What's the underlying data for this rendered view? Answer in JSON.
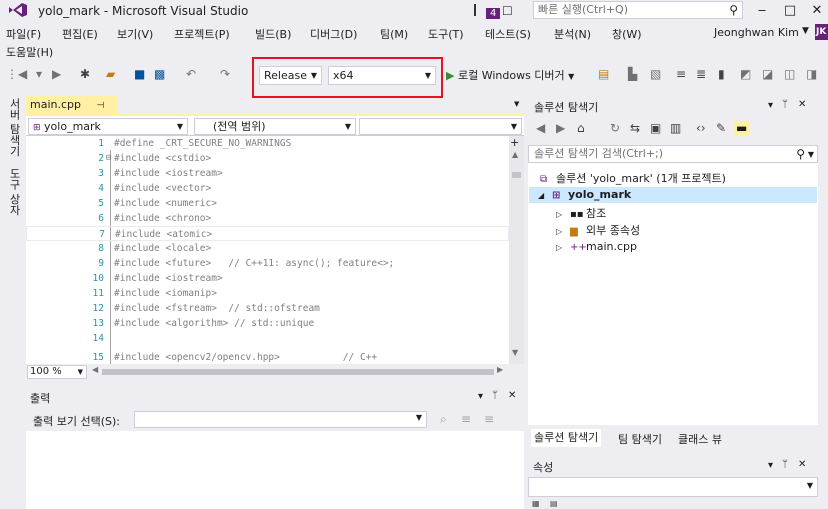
{
  "window": {
    "title": "yolo_mark - Microsoft Visual Studio",
    "notification_count": "4",
    "quick_launch_placeholder": "빠른 실행(Ctrl+Q)",
    "minimize": "‒",
    "maximize": "□",
    "close": "✕"
  },
  "menu": {
    "items": [
      "파일(F)",
      "편집(E)",
      "보기(V)",
      "프로젝트(P)",
      "빌드(B)",
      "디버그(D)",
      "팀(M)",
      "도구(T)",
      "테스트(S)",
      "분석(N)",
      "창(W)"
    ],
    "help": "도움말(H)",
    "user_name": "Jeonghwan Kim",
    "user_initials": "JK"
  },
  "toolbar": {
    "configuration": "Release",
    "platform": "x64",
    "run_label": "로컬 Windows 디버거"
  },
  "left_tabs": {
    "server_explorer": "서버 탐색기",
    "toolbox": "도구 상자"
  },
  "editor": {
    "file_tab": "main.cpp",
    "pin": "⊣",
    "close": "✕",
    "nav_project": "yolo_mark",
    "nav_scope": "(전역 범위)",
    "nav_member": "",
    "zoom": "100 %",
    "lines": [
      {
        "n": "1",
        "text": "#define _CRT_SECURE_NO_WARNINGS"
      },
      {
        "n": "2",
        "text": "#include <cstdio>"
      },
      {
        "n": "3",
        "text": "#include <iostream>"
      },
      {
        "n": "4",
        "text": "#include <vector>"
      },
      {
        "n": "5",
        "text": "#include <numeric>"
      },
      {
        "n": "6",
        "text": "#include <chrono>"
      },
      {
        "n": "7",
        "text": "#include <atomic>"
      },
      {
        "n": "8",
        "text": "#include <locale>"
      },
      {
        "n": "9",
        "text": "#include <future>   // C++11: async(); feature<>;"
      },
      {
        "n": "10",
        "text": "#include <iostream>"
      },
      {
        "n": "11",
        "text": "#include <iomanip>"
      },
      {
        "n": "12",
        "text": "#include <fstream>  // std::ofstream"
      },
      {
        "n": "13",
        "text": "#include <algorithm> // std::unique"
      },
      {
        "n": "14",
        "text": ""
      },
      {
        "n": "15",
        "text": "#include <opencv2/opencv.hpp>           // C++"
      }
    ]
  },
  "output": {
    "title": "출력",
    "source_label": "출력 보기 선택(S):",
    "source_value": ""
  },
  "solution_explorer": {
    "title": "솔루션 탐색기",
    "search_placeholder": "솔루션 탐색기 검색(Ctrl+;)",
    "solution": "솔루션 'yolo_mark' (1개 프로젝트)",
    "project": "yolo_mark",
    "children": [
      "참조",
      "외부 종속성",
      "main.cpp"
    ],
    "tabs": [
      "솔루션 탐색기",
      "팀 탐색기",
      "클래스 뷰"
    ]
  },
  "properties": {
    "title": "속성"
  },
  "colors": {
    "accent": "#68217a",
    "highlight": "#e81123",
    "tab_active": "#fff0a3",
    "selection": "#cce8ff"
  }
}
